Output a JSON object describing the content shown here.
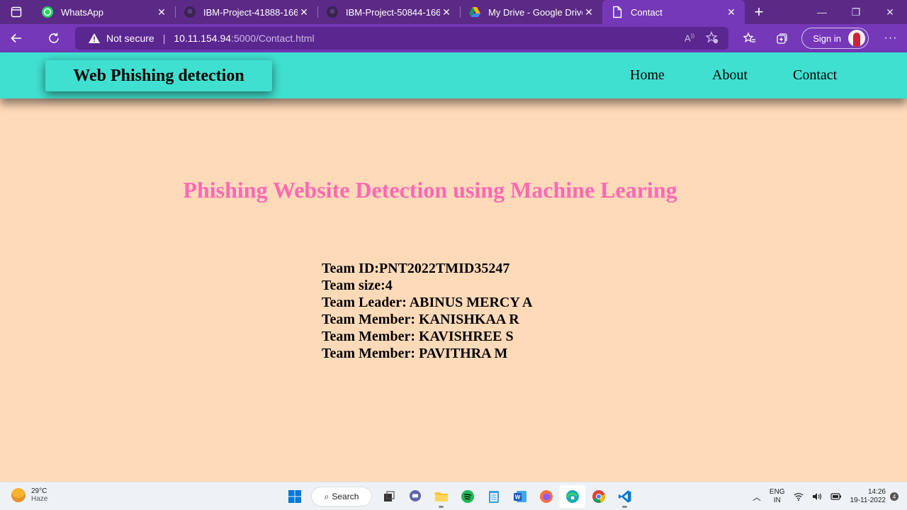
{
  "browser": {
    "tabs": [
      {
        "title": "WhatsApp",
        "icon": "whatsapp-icon",
        "active": false
      },
      {
        "title": "IBM-Project-41888-166",
        "icon": "github-icon",
        "active": false
      },
      {
        "title": "IBM-Project-50844-166",
        "icon": "github-icon",
        "active": false
      },
      {
        "title": "My Drive - Google Drive",
        "icon": "google-drive-icon",
        "active": false
      },
      {
        "title": "Contact",
        "icon": "page-icon",
        "active": true
      }
    ],
    "security_label": "Not secure",
    "url_host": "10.11.154.94",
    "url_rest": ":5000/Contact.html",
    "sign_in_label": "Sign in"
  },
  "site": {
    "brand": "Web Phishing detection",
    "nav": {
      "home": "Home",
      "about": "About",
      "contact": "Contact"
    },
    "heading": "Phishing Website Detection using Machine Learing",
    "team": [
      "Team ID:PNT2022TMID35247",
      "Team size:4",
      "Team Leader: ABINUS MERCY A",
      "Team Member: KANISHKAA R",
      "Team Member: KAVISHREE S",
      "Team Member: PAVITHRA M"
    ]
  },
  "taskbar": {
    "weather_temp": "29°C",
    "weather_desc": "Haze",
    "search_label": "Search",
    "lang_top": "ENG",
    "lang_bottom": "IN",
    "time": "14:26",
    "date": "19-11-2022",
    "notification_count": "4"
  },
  "colors": {
    "page_background": "#FFDAB9",
    "header_background": "#40E0D0",
    "heading_color": "#FF69B4",
    "browser_frame": "#7438B8"
  }
}
